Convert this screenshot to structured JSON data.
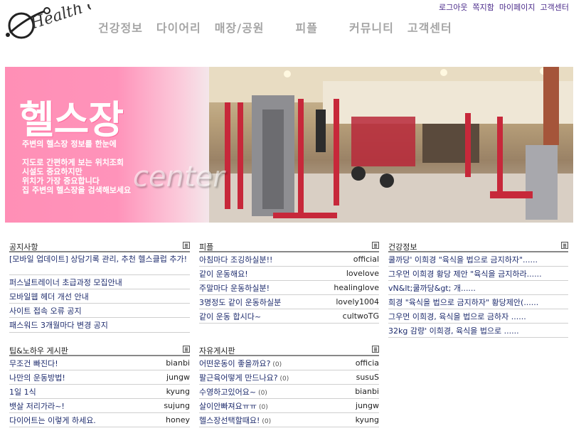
{
  "brand": {
    "logo_text": "Health Club"
  },
  "top_links": [
    "로그아웃",
    "쪽지함",
    "마이페이지",
    "고객센터"
  ],
  "main_nav": [
    "건강정보",
    "다이어리",
    "매장/공원",
    "피플",
    "커뮤니티",
    "고객센터"
  ],
  "banner": {
    "title": "헬스장",
    "subtitle": "주변의 헬스장 정보를 한눈에",
    "desc_lines": [
      "지도로 간편하게 보는 위치조회",
      "시설도 중요하지만",
      "위치가 가장 중요합니다",
      "집 주변의 헬스장을 검색해보세요"
    ],
    "watermark": "center"
  },
  "boards": {
    "notice": {
      "title": "공지사항",
      "items": [
        {
          "text": "[모바일 업데이트] 상담기록 관리, 추천 헬스클럽 추가!"
        },
        {
          "text": "퍼스널트레이너 초급과정 모집안내"
        },
        {
          "text": "모바일웹 헤더 개선 안내"
        },
        {
          "text": "사이트 접속 오류 공지"
        },
        {
          "text": "패스워드 3개월마다 변경 공지"
        }
      ]
    },
    "people": {
      "title": "피플",
      "items": [
        {
          "text": "아침마다 조깅하실분!!",
          "writer": "official"
        },
        {
          "text": "같이 운동해요!",
          "writer": "lovelove"
        },
        {
          "text": "주말마다 운동하실분!",
          "writer": "healinglove"
        },
        {
          "text": "3명정도 같이 운동하실분",
          "writer": "lovely1004"
        },
        {
          "text": "같이 운동 합시다~",
          "writer": "cultwoTG"
        }
      ]
    },
    "health": {
      "title": "건강정보",
      "items": [
        {
          "text": "쿨까당' 이희경 \"육식을 법으로 금지하자\"......"
        },
        {
          "text": "그우먼 이희경 황당 제안 \"육식을 금지하라......"
        },
        {
          "text": "vN&lt;쿨까당&gt; 개......"
        },
        {
          "text": "희경 \"육식을 법으로 금지하자\" 황당제안(......"
        },
        {
          "text": "그우먼 이희경, 육식을 법으로 금하자 ......"
        },
        {
          "text": "32kg 감량' 이희경, 육식을 법으로 ......"
        }
      ]
    },
    "tips": {
      "title": "팁&노하우 게시판",
      "items": [
        {
          "text": "무조건 빠진다!",
          "writer": "bianbi"
        },
        {
          "text": "나만의 운동방법!",
          "writer": "jungw"
        },
        {
          "text": "1일 1식",
          "writer": "kyung"
        },
        {
          "text": "뱃살 저리가라~!",
          "writer": "sujung"
        },
        {
          "text": "다이어트는 이렇게 하세요.",
          "writer": "honey"
        }
      ]
    },
    "free": {
      "title": "자유게시판",
      "items": [
        {
          "text": "어떤운동이 좋을까요?",
          "count": "(0)",
          "writer": "officia"
        },
        {
          "text": "팔근육어떻게 만드나요?",
          "count": "(0)",
          "writer": "susuS"
        },
        {
          "text": "수영하고있어요~",
          "count": "(0)",
          "writer": "bianbi"
        },
        {
          "text": "살이안빠져요ㅠㅠ",
          "count": "(0)",
          "writer": "jungw"
        },
        {
          "text": "헬스장선택할때요!",
          "count": "(0)",
          "writer": "kyung"
        }
      ]
    }
  },
  "colors": {
    "nav_gray": "#a5a5a5",
    "link_navy": "#1f2d6e",
    "top_link_purple": "#4a2a8a",
    "banner_pink": "#ff8fb6"
  }
}
